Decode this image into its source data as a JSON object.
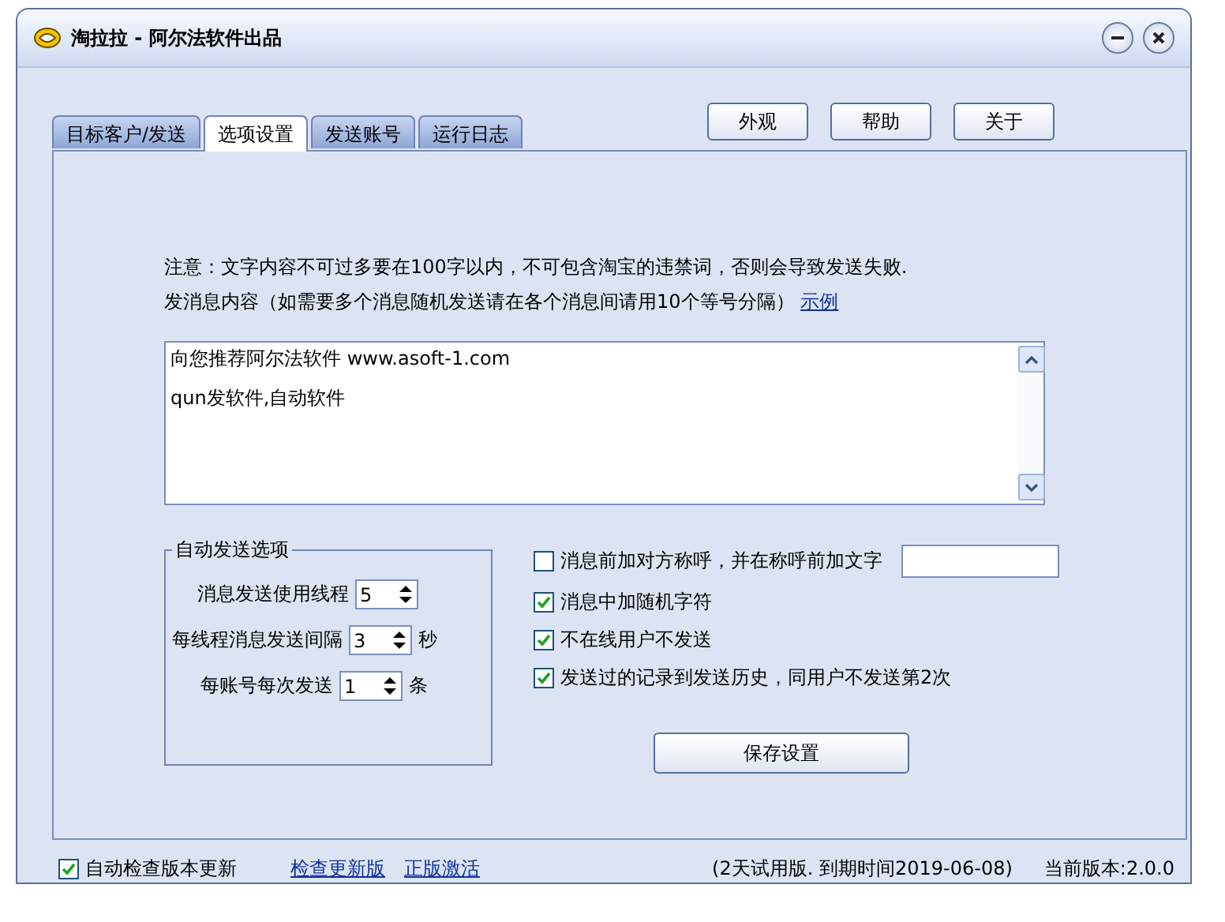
{
  "window": {
    "title": "淘拉拉 - 阿尔法软件出品"
  },
  "tabs": [
    {
      "label": "目标客户/发送",
      "selected": false
    },
    {
      "label": "选项设置",
      "selected": true
    },
    {
      "label": "发送账号",
      "selected": false
    },
    {
      "label": "运行日志",
      "selected": false
    }
  ],
  "header_buttons": [
    "外观",
    "帮助",
    "关于"
  ],
  "notice": "注意：文字内容不可过多要在100字以内，不可包含淘宝的违禁词，否则会导致发送失败.",
  "content_label": {
    "text": "发消息内容（如需要多个消息随机发送请在各个消息间请用10个等号分隔）",
    "link": "示例"
  },
  "message_lines": [
    "向您推荐阿尔法软件 www.asoft-1.com",
    "qun发软件,自动软件"
  ],
  "auto_send": {
    "title": "自动发送选项",
    "spinners": [
      {
        "label": "消息发送使用线程",
        "value": "5"
      },
      {
        "label": "每线程消息发送间隔",
        "value": "3",
        "unit": "秒"
      },
      {
        "label": "每账号每次发送",
        "value": "1",
        "unit": "条"
      }
    ]
  },
  "options": [
    {
      "kind": "checkbox_field",
      "label": "消息前加对方称呼，并在称呼前加文字",
      "checked": false
    },
    {
      "kind": "checkbox",
      "label": "消息中加随机字符",
      "checked": true
    },
    {
      "kind": "checkbox",
      "label": "不在线用户不发送",
      "checked": true
    },
    {
      "kind": "checkbox",
      "label": "发送过的记录到发送历史，同用户不发送第2次",
      "checked": true
    }
  ],
  "save_button": "保存设置",
  "footer": {
    "auto_check": {
      "label": "自动检查版本更新",
      "checked": true
    },
    "links": [
      "检查更新版",
      "正版激活"
    ],
    "trial_info": "(2天试用版. 到期时间2019-06-08)",
    "version": "当前版本:2.0.0"
  }
}
